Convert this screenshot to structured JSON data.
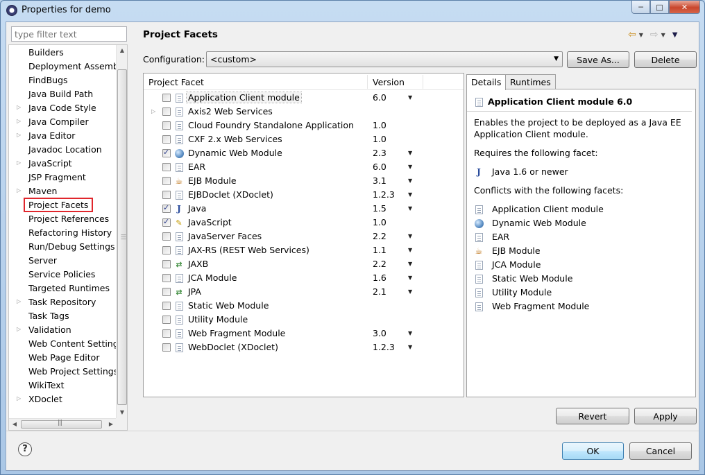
{
  "window": {
    "title": "Properties for demo",
    "controls": {
      "minimize": "─",
      "maximize": "□",
      "close": "✕"
    }
  },
  "nav": {
    "filter_placeholder": "type filter text",
    "items": [
      {
        "label": "Builders",
        "expandable": false
      },
      {
        "label": "Deployment Assembly",
        "expandable": false
      },
      {
        "label": "FindBugs",
        "expandable": false
      },
      {
        "label": "Java Build Path",
        "expandable": false
      },
      {
        "label": "Java Code Style",
        "expandable": true
      },
      {
        "label": "Java Compiler",
        "expandable": true
      },
      {
        "label": "Java Editor",
        "expandable": true
      },
      {
        "label": "Javadoc Location",
        "expandable": false
      },
      {
        "label": "JavaScript",
        "expandable": true
      },
      {
        "label": "JSP Fragment",
        "expandable": false
      },
      {
        "label": "Maven",
        "expandable": true
      },
      {
        "label": "Project Facets",
        "expandable": false,
        "selected": true
      },
      {
        "label": "Project References",
        "expandable": false
      },
      {
        "label": "Refactoring History",
        "expandable": false
      },
      {
        "label": "Run/Debug Settings",
        "expandable": false
      },
      {
        "label": "Server",
        "expandable": false
      },
      {
        "label": "Service Policies",
        "expandable": false
      },
      {
        "label": "Targeted Runtimes",
        "expandable": false
      },
      {
        "label": "Task Repository",
        "expandable": true
      },
      {
        "label": "Task Tags",
        "expandable": false
      },
      {
        "label": "Validation",
        "expandable": true
      },
      {
        "label": "Web Content Settings",
        "expandable": false
      },
      {
        "label": "Web Page Editor",
        "expandable": false
      },
      {
        "label": "Web Project Settings",
        "expandable": false
      },
      {
        "label": "WikiText",
        "expandable": false
      },
      {
        "label": "XDoclet",
        "expandable": true
      }
    ]
  },
  "page": {
    "title": "Project Facets",
    "config_label": "Configuration:",
    "config_value": "<custom>",
    "save_as": "Save As...",
    "delete": "Delete",
    "revert": "Revert",
    "apply": "Apply",
    "columns": {
      "facet": "Project Facet",
      "version": "Version"
    },
    "facets": [
      {
        "name": "Application Client module",
        "version": "6.0",
        "checked": false,
        "dropdown": true,
        "icon": "doc",
        "selected": true
      },
      {
        "name": "Axis2 Web Services",
        "version": "",
        "checked": false,
        "dropdown": false,
        "icon": "doc",
        "expandable": true
      },
      {
        "name": "Cloud Foundry Standalone Application",
        "version": "1.0",
        "checked": false,
        "dropdown": false,
        "icon": "doc"
      },
      {
        "name": "CXF 2.x Web Services",
        "version": "1.0",
        "checked": false,
        "dropdown": false,
        "icon": "doc"
      },
      {
        "name": "Dynamic Web Module",
        "version": "2.3",
        "checked": true,
        "dropdown": true,
        "icon": "globe"
      },
      {
        "name": "EAR",
        "version": "6.0",
        "checked": false,
        "dropdown": true,
        "icon": "doc"
      },
      {
        "name": "EJB Module",
        "version": "3.1",
        "checked": false,
        "dropdown": true,
        "icon": "bean"
      },
      {
        "name": "EJBDoclet (XDoclet)",
        "version": "1.2.3",
        "checked": false,
        "dropdown": true,
        "icon": "doc"
      },
      {
        "name": "Java",
        "version": "1.5",
        "checked": true,
        "dropdown": true,
        "icon": "java"
      },
      {
        "name": "JavaScript",
        "version": "1.0",
        "checked": true,
        "dropdown": false,
        "icon": "js"
      },
      {
        "name": "JavaServer Faces",
        "version": "2.2",
        "checked": false,
        "dropdown": true,
        "icon": "doc"
      },
      {
        "name": "JAX-RS (REST Web Services)",
        "version": "1.1",
        "checked": false,
        "dropdown": true,
        "icon": "doc"
      },
      {
        "name": "JAXB",
        "version": "2.2",
        "checked": false,
        "dropdown": true,
        "icon": "xml"
      },
      {
        "name": "JCA Module",
        "version": "1.6",
        "checked": false,
        "dropdown": true,
        "icon": "doc"
      },
      {
        "name": "JPA",
        "version": "2.1",
        "checked": false,
        "dropdown": true,
        "icon": "xml"
      },
      {
        "name": "Static Web Module",
        "version": "",
        "checked": false,
        "dropdown": false,
        "icon": "doc"
      },
      {
        "name": "Utility Module",
        "version": "",
        "checked": false,
        "dropdown": false,
        "icon": "doc"
      },
      {
        "name": "Web Fragment Module",
        "version": "3.0",
        "checked": false,
        "dropdown": true,
        "icon": "doc"
      },
      {
        "name": "WebDoclet (XDoclet)",
        "version": "1.2.3",
        "checked": false,
        "dropdown": true,
        "icon": "doc"
      }
    ]
  },
  "details": {
    "tab_details": "Details",
    "tab_runtimes": "Runtimes",
    "title": "Application Client module 6.0",
    "description": [
      "Enables the project to be deployed as a Java EE",
      "Application Client module."
    ],
    "requires_label": "Requires the following facet:",
    "requires": [
      {
        "label": "Java 1.6 or newer",
        "icon": "java"
      }
    ],
    "conflicts_label": "Conflicts with the following facets:",
    "conflicts": [
      {
        "label": "Application Client module",
        "icon": "doc"
      },
      {
        "label": "Dynamic Web Module",
        "icon": "globe"
      },
      {
        "label": "EAR",
        "icon": "doc"
      },
      {
        "label": "EJB Module",
        "icon": "bean"
      },
      {
        "label": "JCA Module",
        "icon": "doc"
      },
      {
        "label": "Static Web Module",
        "icon": "doc"
      },
      {
        "label": "Utility Module",
        "icon": "doc"
      },
      {
        "label": "Web Fragment Module",
        "icon": "doc"
      }
    ]
  },
  "footer": {
    "ok": "OK",
    "cancel": "Cancel",
    "help": "?"
  }
}
